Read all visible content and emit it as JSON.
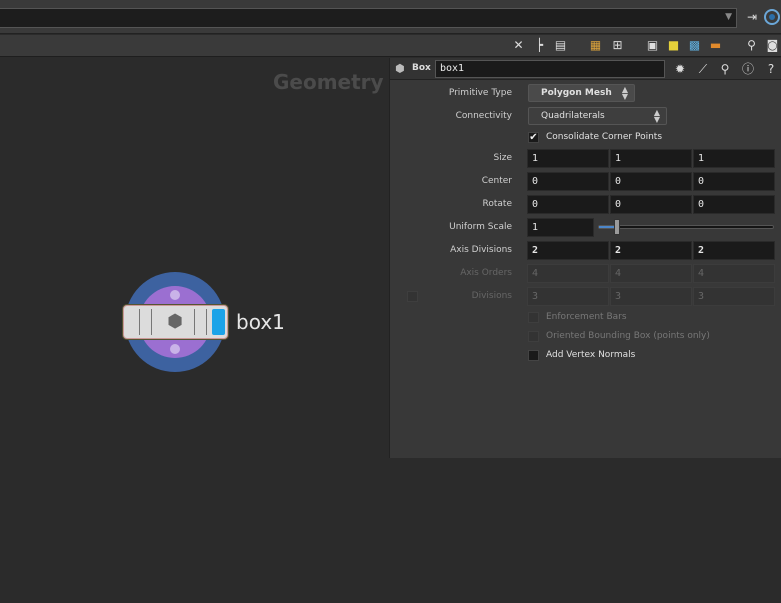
{
  "network": {
    "context_title": "Geometry",
    "node": {
      "name": "box1",
      "type": "Box"
    }
  },
  "params": {
    "primitive_type": {
      "label": "Primitive Type",
      "value": "Polygon Mesh"
    },
    "connectivity": {
      "label": "Connectivity",
      "value": "Quadrilaterals"
    },
    "consolidate": {
      "label": "Consolidate Corner Points",
      "checked": true
    },
    "size": {
      "label": "Size",
      "values": [
        "1",
        "1",
        "1"
      ]
    },
    "center": {
      "label": "Center",
      "values": [
        "0",
        "0",
        "0"
      ]
    },
    "rotate": {
      "label": "Rotate",
      "values": [
        "0",
        "0",
        "0"
      ]
    },
    "uniform_scale": {
      "label": "Uniform Scale",
      "value": "1",
      "slider_fraction": 0.09
    },
    "axis_divisions": {
      "label": "Axis Divisions",
      "values": [
        "2",
        "2",
        "2"
      ]
    },
    "axis_orders": {
      "label": "Axis Orders",
      "values": [
        "4",
        "4",
        "4"
      ]
    },
    "divisions": {
      "label": "Divisions",
      "values": [
        "3",
        "3",
        "3"
      ]
    },
    "enforcement_bars": {
      "label": "Enforcement Bars"
    },
    "oriented_bbox": {
      "label": "Oriented Bounding Box (points only)"
    },
    "add_vertex_normals": {
      "label": "Add Vertex Normals"
    }
  },
  "colors": {
    "node_ring": "#3d62a0",
    "node_ring_inner": "#9b6fd1",
    "node_flag": "#1ba3e8",
    "slider_fill": "#4c86c9"
  },
  "icons": {
    "pin": "⇥",
    "toolbar": [
      "wrench-icon",
      "tree-icon",
      "list-icon",
      "palette-icon",
      "grid-icon",
      "image-icon",
      "sticky-note-icon",
      "picture-icon",
      "network-box-icon",
      "magnify-icon",
      "view-icon"
    ],
    "param_header": [
      "gear-icon",
      "brush-icon",
      "search-icon",
      "info-icon",
      "help-icon"
    ]
  }
}
